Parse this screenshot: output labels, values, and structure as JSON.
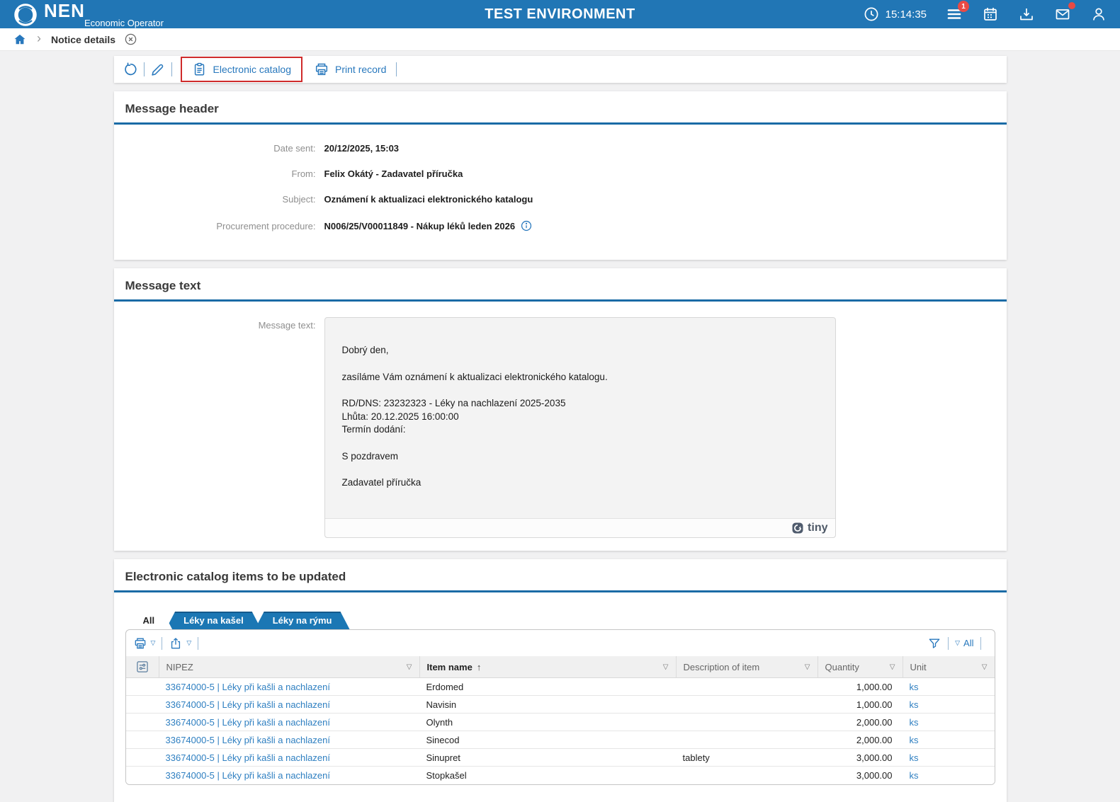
{
  "topbar": {
    "brand": "NEN",
    "brand_subtitle": "Economic Operator",
    "title": "TEST ENVIRONMENT",
    "time": "15:14:35",
    "menu_badge": "1"
  },
  "breadcrumb": {
    "page_title": "Notice details"
  },
  "toolbar": {
    "electronic_catalog_label": "Electronic catalog",
    "print_record_label": "Print record"
  },
  "message_header": {
    "title": "Message header",
    "fields": [
      {
        "label": "Date sent:",
        "value": "20/12/2025, 15:03",
        "info": false
      },
      {
        "label": "From:",
        "value": "Felix Okátý - Zadavatel příručka",
        "info": false
      },
      {
        "label": "Subject:",
        "value": "Oznámení k aktualizaci elektronického katalogu",
        "info": false
      },
      {
        "label": "Procurement procedure:",
        "value": "N006/25/V00011849 - Nákup léků leden 2026",
        "info": true
      }
    ]
  },
  "message_text": {
    "title": "Message text",
    "label": "Message text:",
    "paragraphs": [
      [
        "Dobrý den,"
      ],
      [
        "zasíláme Vám oznámení k aktualizaci elektronického katalogu."
      ],
      [
        "RD/DNS: 23232323 - Léky na nachlazení 2025-2035",
        "Lhůta: 20.12.2025 16:00:00",
        "Termín dodání:"
      ],
      [
        "S pozdravem"
      ],
      [
        "Zadavatel příručka"
      ]
    ],
    "editor_brand": "tiny"
  },
  "catalog": {
    "title": "Electronic catalog items to be updated",
    "tabs": [
      {
        "label": "All",
        "active": true
      },
      {
        "label": "Léky na kašel",
        "active": false
      },
      {
        "label": "Léky na rýmu",
        "active": false
      }
    ],
    "filter_all_label": "All",
    "table": {
      "columns": [
        {
          "label": "NIPEZ",
          "sorted": false
        },
        {
          "label": "Item name",
          "sorted": true
        },
        {
          "label": "Description of item",
          "sorted": false
        },
        {
          "label": "Quantity",
          "sorted": false
        },
        {
          "label": "Unit",
          "sorted": false
        }
      ],
      "rows": [
        {
          "nipez": "33674000-5 | Léky při kašli a nachlazení",
          "item_name": "Erdomed",
          "description": "",
          "quantity": "1,000.00",
          "unit": "ks"
        },
        {
          "nipez": "33674000-5 | Léky při kašli a nachlazení",
          "item_name": "Navisin",
          "description": "",
          "quantity": "1,000.00",
          "unit": "ks"
        },
        {
          "nipez": "33674000-5 | Léky při kašli a nachlazení",
          "item_name": "Olynth",
          "description": "",
          "quantity": "2,000.00",
          "unit": "ks"
        },
        {
          "nipez": "33674000-5 | Léky při kašli a nachlazení",
          "item_name": "Sinecod",
          "description": "",
          "quantity": "2,000.00",
          "unit": "ks"
        },
        {
          "nipez": "33674000-5 | Léky při kašli a nachlazení",
          "item_name": "Sinupret",
          "description": "tablety",
          "quantity": "3,000.00",
          "unit": "ks"
        },
        {
          "nipez": "33674000-5 | Léky při kašli a nachlazení",
          "item_name": "Stopkašel",
          "description": "",
          "quantity": "3,000.00",
          "unit": "ks"
        }
      ]
    }
  },
  "colors": {
    "topbar_blue": "#2176b5",
    "accent_blue": "#2878bd",
    "link_blue": "#2e7fc1",
    "tab_blue": "#1b77b4",
    "section_rule": "#1a6ba6",
    "badge_red": "#e84a45",
    "annotation_red": "#cf2b2b"
  }
}
